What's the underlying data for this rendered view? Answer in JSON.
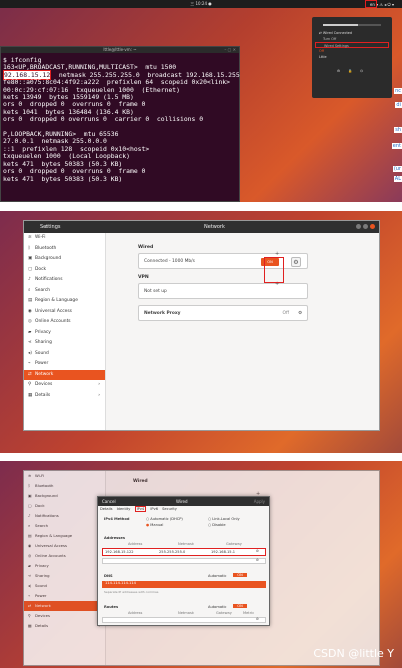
{
  "panel1": {
    "topbar_clock": "三 10:24 ●",
    "tray": "en ▾  ⚠ ◂ ⏻ ▾",
    "terminal_title": "lttle@lttle-vm: ~",
    "terminal_lines": [
      "$ ifconfig",
      "163<UP,BROADCAST,RUNNING,MULTICAST>  mtu 1500",
      "92.168.15.12  netmask 255.255.255.0  broadcast 192.168.15.255",
      "fe80::a075:8c04:4f92:a222  prefixlen 64  scopeid 0x20<link>",
      "00:0c:29:cf:07:16  txqueuelen 1000  (Ethernet)",
      "kets 13949  bytes 1559149 (1.5 MB)",
      "ors 0  dropped 0  overruns 0  frame 0",
      "kets 1041  bytes 136484 (136.4 KB)",
      "ors 0  dropped 0 overruns 0  carrier 0  collisions 0",
      "",
      "P,LOOPBACK,RUNNING>  mtu 65536",
      "27.0.0.1  netmask 255.0.0.0",
      "::1  prefixlen 128  scopeid 0x10<host>",
      "txqueuelen 1000  (Local Loopback)",
      "kets 471  bytes 50383 (50.3 KB)",
      "ors 0  dropped 0  overruns 0  frame 0",
      "kets 471  bytes 50383 (50.3 KB)"
    ],
    "ip_highlight": "92.168.15.12",
    "menu": {
      "wired": "Wired Connected",
      "turn_off": "Turn Off",
      "wired_settings": "Wired Settings",
      "item3": "Off",
      "item4": "Lttle"
    },
    "sidetexts": [
      "nc",
      "di",
      "sh",
      "ent",
      "(ur",
      "AL"
    ]
  },
  "settings": {
    "title": "Settings",
    "network_title": "Network",
    "sidebar": [
      {
        "icon": "wifi-icon",
        "glyph": "≋",
        "label": "Wi-Fi"
      },
      {
        "icon": "bluetooth-icon",
        "glyph": "ᛒ",
        "label": "Bluetooth"
      },
      {
        "icon": "background-icon",
        "glyph": "▣",
        "label": "Background"
      },
      {
        "icon": "dock-icon",
        "glyph": "▢",
        "label": "Dock"
      },
      {
        "icon": "bell-icon",
        "glyph": "♪",
        "label": "Notifications"
      },
      {
        "icon": "search-icon",
        "glyph": "⌕",
        "label": "Search"
      },
      {
        "icon": "region-icon",
        "glyph": "▤",
        "label": "Region & Language"
      },
      {
        "icon": "access-icon",
        "glyph": "◉",
        "label": "Universal Access"
      },
      {
        "icon": "online-icon",
        "glyph": "◎",
        "label": "Online Accounts"
      },
      {
        "icon": "privacy-icon",
        "glyph": "▰",
        "label": "Privacy"
      },
      {
        "icon": "sharing-icon",
        "glyph": "⋖",
        "label": "Sharing"
      },
      {
        "icon": "sound-icon",
        "glyph": "◂)",
        "label": "Sound"
      },
      {
        "icon": "power-icon",
        "glyph": "⌁",
        "label": "Power"
      },
      {
        "icon": "network-icon",
        "glyph": "⇄",
        "label": "Network"
      },
      {
        "icon": "devices-icon",
        "glyph": "⚲",
        "label": "Devices"
      },
      {
        "icon": "details-icon",
        "glyph": "▦",
        "label": "Details"
      }
    ],
    "wired_label": "Wired",
    "connected": "Connected - 1000 Mb/s",
    "toggle_on": "ON",
    "vpn_label": "VPN",
    "not_setup": "Not set up",
    "proxy_label": "Network Proxy",
    "proxy_off": "Off"
  },
  "dialog": {
    "cancel": "Cancel",
    "title": "Wired",
    "apply": "Apply",
    "tabs": [
      "Details",
      "Identity",
      "IPv4",
      "IPv6",
      "Security"
    ],
    "ipv4_method": "IPv4 Method",
    "auto": "Automatic (DHCP)",
    "manual": "Manual",
    "link_local": "Link-Local Only",
    "disable": "Disable",
    "addresses": "Addresses",
    "col_address": "Address",
    "col_netmask": "Netmask",
    "col_gateway": "Gateway",
    "address": "192.168.15.122",
    "netmask": "255.255.255.0",
    "gateway": "192.168.15.1",
    "dns": "DNS",
    "automatic": "Automatic",
    "dns_value": "114.114.114.114",
    "dns_hint": "Separate IP addresses with commas",
    "routes": "Routes",
    "metric": "Metric"
  },
  "watermark": "CSDN @little Y"
}
